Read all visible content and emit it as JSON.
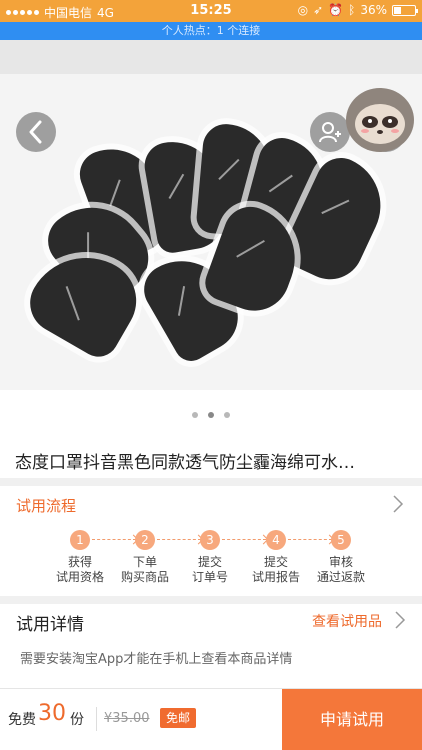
{
  "status_bar": {
    "carrier": "中国电信",
    "network": "4G",
    "time": "15:25",
    "battery": "36%",
    "battery_level": 0.36
  },
  "hotspot_banner": "个人热点：1 个连接",
  "header": {
    "back_icon": "chevron-left-icon",
    "friend_icon": "add-user-icon",
    "share_icon": "share-icon"
  },
  "gallery": {
    "page_count": 3,
    "active_page": 1
  },
  "product": {
    "title": "态度口罩抖音黑色同款透气防尘霾海绵可水…"
  },
  "process": {
    "label": "试用流程",
    "steps": [
      {
        "num": "1",
        "line1": "获得",
        "line2": "试用资格"
      },
      {
        "num": "2",
        "line1": "下单",
        "line2": "购买商品"
      },
      {
        "num": "3",
        "line1": "提交",
        "line2": "订单号"
      },
      {
        "num": "4",
        "line1": "提交",
        "line2": "试用报告"
      },
      {
        "num": "5",
        "line1": "审核",
        "line2": "通过返款"
      }
    ]
  },
  "details": {
    "label": "试用详情",
    "link": "查看试用品",
    "note": "需要安装淘宝App才能在手机上查看本商品详情"
  },
  "bottom_bar": {
    "free_label": "免费",
    "free_count": "30",
    "free_unit": "份",
    "original_price": "¥35.00",
    "shipping_badge": "免邮",
    "apply_button": "申请试用"
  },
  "colors": {
    "accent": "#ee6a2c",
    "status_bar": "#f3a33a",
    "hotspot_bar": "#2f8ef2"
  }
}
